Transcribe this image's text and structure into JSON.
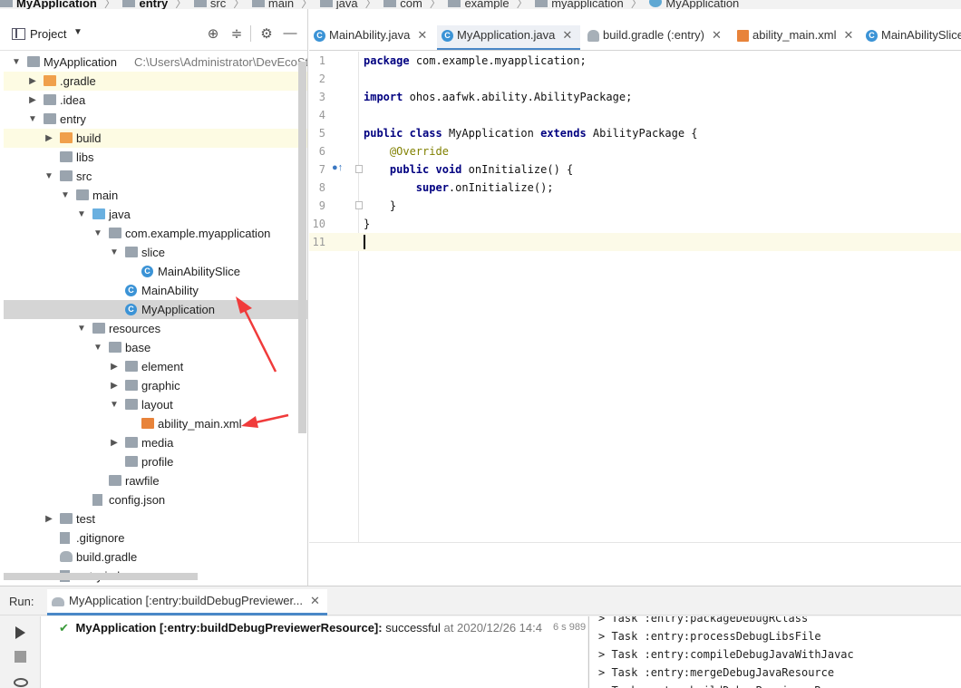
{
  "breadcrumb": [
    "MyApplication",
    "entry",
    "src",
    "main",
    "java",
    "com",
    "example",
    "myapplication",
    "MyApplication"
  ],
  "project_panel": {
    "title": "Project",
    "tree": [
      {
        "label": "MyApplication",
        "path": "C:\\Users\\Administrator\\DevEcoStud",
        "depth": 0,
        "expanded": true,
        "icon": "module-folder-icon"
      },
      {
        "label": ".gradle",
        "depth": 1,
        "expanded": false,
        "icon": "orange-folder-icon"
      },
      {
        "label": ".idea",
        "depth": 1,
        "expanded": false,
        "icon": "folder-icon"
      },
      {
        "label": "entry",
        "depth": 1,
        "expanded": true,
        "icon": "module-folder-icon"
      },
      {
        "label": "build",
        "depth": 2,
        "expanded": false,
        "icon": "orange-folder-icon"
      },
      {
        "label": "libs",
        "depth": 2,
        "icon": "folder-icon"
      },
      {
        "label": "src",
        "depth": 2,
        "expanded": true,
        "icon": "folder-icon"
      },
      {
        "label": "main",
        "depth": 3,
        "expanded": true,
        "icon": "folder-icon"
      },
      {
        "label": "java",
        "depth": 4,
        "expanded": true,
        "icon": "blue-folder-icon"
      },
      {
        "label": "com.example.myapplication",
        "depth": 5,
        "expanded": true,
        "icon": "package-icon"
      },
      {
        "label": "slice",
        "depth": 6,
        "expanded": true,
        "icon": "package-icon"
      },
      {
        "label": "MainAbilitySlice",
        "depth": 7,
        "icon": "class-icon"
      },
      {
        "label": "MainAbility",
        "depth": 6,
        "icon": "class-icon"
      },
      {
        "label": "MyApplication",
        "depth": 6,
        "icon": "class-icon"
      },
      {
        "label": "resources",
        "depth": 4,
        "expanded": true,
        "icon": "resources-folder-icon"
      },
      {
        "label": "base",
        "depth": 5,
        "expanded": true,
        "icon": "folder-icon"
      },
      {
        "label": "element",
        "depth": 6,
        "expanded": false,
        "icon": "folder-icon"
      },
      {
        "label": "graphic",
        "depth": 6,
        "expanded": false,
        "icon": "folder-icon"
      },
      {
        "label": "layout",
        "depth": 6,
        "expanded": true,
        "icon": "folder-icon"
      },
      {
        "label": "ability_main.xml",
        "depth": 7,
        "icon": "xml-file-icon"
      },
      {
        "label": "media",
        "depth": 6,
        "expanded": false,
        "icon": "folder-icon"
      },
      {
        "label": "profile",
        "depth": 6,
        "icon": "folder-icon"
      },
      {
        "label": "rawfile",
        "depth": 5,
        "icon": "folder-icon"
      },
      {
        "label": "config.json",
        "depth": 4,
        "icon": "json-file-icon"
      },
      {
        "label": "test",
        "depth": 2,
        "expanded": false,
        "icon": "folder-icon"
      },
      {
        "label": ".gitignore",
        "depth": 2,
        "icon": "file-icon"
      },
      {
        "label": "build.gradle",
        "depth": 2,
        "icon": "gradle-icon"
      },
      {
        "label": "entry.iml",
        "depth": 2,
        "icon": "file-icon"
      }
    ]
  },
  "editor_tabs": [
    {
      "label": "MainAbility.java",
      "icon": "class-icon",
      "active": false
    },
    {
      "label": "MyApplication.java",
      "icon": "class-icon",
      "active": true
    },
    {
      "label": "build.gradle (:entry)",
      "icon": "gradle-icon",
      "active": false
    },
    {
      "label": "ability_main.xml",
      "icon": "xml-file-icon",
      "active": false
    },
    {
      "label": "MainAbilitySlice",
      "icon": "class-icon",
      "active": false
    }
  ],
  "code_lines": [
    {
      "n": "1",
      "text": "package com.example.myapplication;"
    },
    {
      "n": "2",
      "text": ""
    },
    {
      "n": "3",
      "text": "import ohos.aafwk.ability.AbilityPackage;"
    },
    {
      "n": "4",
      "text": ""
    },
    {
      "n": "5",
      "text": "public class MyApplication extends AbilityPackage {"
    },
    {
      "n": "6",
      "text": "    @Override"
    },
    {
      "n": "7",
      "text": "    public void onInitialize() {"
    },
    {
      "n": "8",
      "text": "        super.onInitialize();"
    },
    {
      "n": "9",
      "text": "    }"
    },
    {
      "n": "10",
      "text": "}"
    },
    {
      "n": "11",
      "text": ""
    }
  ],
  "run_panel": {
    "label": "Run:",
    "tab_label": "MyApplication [:entry:buildDebugPreviewer...",
    "build_title": "MyApplication [:entry:buildDebugPreviewerResource]:",
    "build_status": "successful",
    "build_time": "at 2020/12/26 14:4",
    "build_duration": "6 s 989 ms",
    "console": [
      "> Task :entry:packageDebugRClass",
      "> Task :entry:processDebugLibsFile",
      "> Task :entry:compileDebugJavaWithJavac",
      "> Task :entry:mergeDebugJavaResource",
      "> Task :entry:buildDebugPreviewerResource"
    ]
  },
  "colors": {
    "accent": "#4a88c7",
    "keyword": "#000080",
    "annotation": "#808000",
    "arrow": "#f03b3b",
    "selection": "#d5d5d5",
    "highlight": "#fdfbe3"
  }
}
